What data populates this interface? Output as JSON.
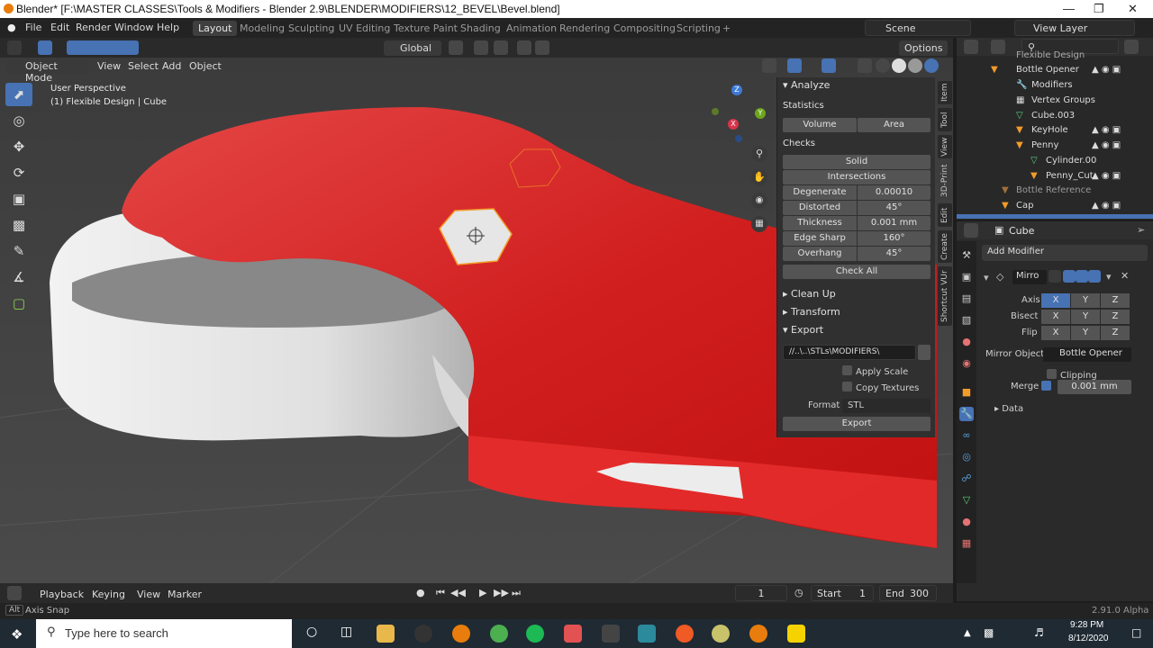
{
  "window": {
    "title": "Blender* [F:\\MASTER CLASSES\\Tools & Modifiers - Blender 2.9\\BLENDER\\MODIFIERS\\12_BEVEL\\Bevel.blend]"
  },
  "menu": [
    "File",
    "Edit",
    "Render",
    "Window",
    "Help"
  ],
  "workspaces": [
    "Layout",
    "Modeling",
    "Sculpting",
    "UV Editing",
    "Texture Paint",
    "Shading",
    "Animation",
    "Rendering",
    "Compositing",
    "Scripting"
  ],
  "active_workspace": "Layout",
  "add_tab": "+",
  "scene": "Scene",
  "view_layer": "View Layer",
  "viewport_header": {
    "mode": "Object Mode",
    "menus": [
      "View",
      "Select",
      "Add",
      "Object"
    ],
    "transform_orientation": "Global",
    "options": "Options"
  },
  "viewport": {
    "perspective": "User Perspective",
    "object": "(1) Flexible Design | Cube",
    "gizmo": {
      "z": "Z",
      "y": "Y",
      "x": "X"
    }
  },
  "npanel": {
    "analyze": "Analyze",
    "statistics": "Statistics",
    "volume": "Volume",
    "area": "Area",
    "checks": "Checks",
    "solid": "Solid",
    "intersections": "Intersections",
    "rows": [
      {
        "label": "Degenerate",
        "value": "0.00010"
      },
      {
        "label": "Distorted",
        "value": "45°"
      },
      {
        "label": "Thickness",
        "value": "0.001 mm"
      },
      {
        "label": "Edge Sharp",
        "value": "160°"
      },
      {
        "label": "Overhang",
        "value": "45°"
      }
    ],
    "check_all": "Check All",
    "clean_up": "Clean Up",
    "transform": "Transform",
    "export": "Export",
    "export_path": "//..\\..\\STLs\\MODIFIERS\\",
    "apply_scale": "Apply Scale",
    "copy_textures": "Copy Textures",
    "format_label": "Format",
    "format_value": "STL",
    "export_button": "Export",
    "tabs": [
      "Item",
      "Tool",
      "View",
      "3D-Print",
      "Edit",
      "Create",
      "Shortcut VUr"
    ]
  },
  "outliner": {
    "search_placeholder": "",
    "items": [
      {
        "name": "Flexible Design"
      },
      {
        "name": "Bottle Opener"
      },
      {
        "name": "Modifiers"
      },
      {
        "name": "Vertex Groups"
      },
      {
        "name": "Cube.003"
      },
      {
        "name": "KeyHole"
      },
      {
        "name": "Penny"
      },
      {
        "name": "Cylinder.00"
      },
      {
        "name": "Penny_Cut"
      },
      {
        "name": "Bottle Reference"
      },
      {
        "name": "Cap"
      }
    ]
  },
  "properties": {
    "object_name": "Cube",
    "add_modifier": "Add Modifier",
    "modifier_name": "Mirro",
    "axis_label": "Axis",
    "bisect_label": "Bisect",
    "flip_label": "Flip",
    "x": "X",
    "y": "Y",
    "z": "Z",
    "mirror_object_label": "Mirror Object",
    "mirror_object_value": "Bottle Opener",
    "clipping": "Clipping",
    "merge_label": "Merge",
    "merge_value": "0.001 mm",
    "data": "Data"
  },
  "timeline": {
    "menus": [
      "Playback",
      "Keying",
      "View",
      "Marker"
    ],
    "current_frame": "1",
    "start_label": "Start",
    "start": "1",
    "end_label": "End",
    "end": "300"
  },
  "status": {
    "key": "Alt",
    "hint": "Axis Snap",
    "version": "2.91.0 Alpha"
  },
  "taskbar": {
    "search_placeholder": "Type here to search",
    "time": "9:28 PM",
    "date": "8/12/2020"
  },
  "colors": {
    "accent": "#4772b3",
    "object_red": "#d42020",
    "panel": "#303030"
  }
}
